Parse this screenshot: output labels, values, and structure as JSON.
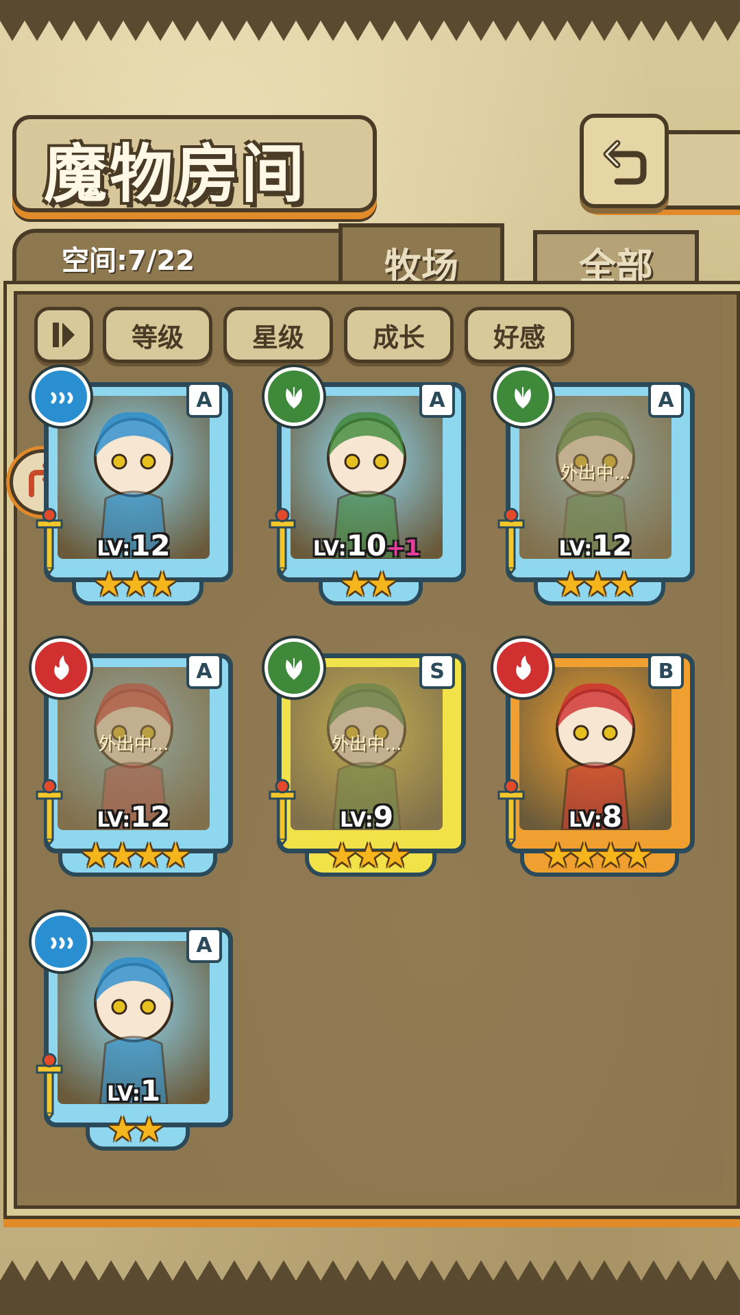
{
  "header": {
    "title": "魔物房间",
    "back_icon": "return-arrow-icon"
  },
  "storage": {
    "space_label": "空间:7/22"
  },
  "tabs": [
    {
      "label": "牧场",
      "active": true
    },
    {
      "label": "全部",
      "active": false
    }
  ],
  "sort_buttons": {
    "toggle_icon": "sort-order-icon",
    "items": [
      "等级",
      "星级",
      "成长",
      "好感"
    ]
  },
  "monsters": [
    {
      "element": "water",
      "rank": "A",
      "level": "12",
      "bonus": "",
      "stars": 3,
      "status": "",
      "frame_color": "#8fd6ef"
    },
    {
      "element": "nature",
      "rank": "A",
      "level": "10",
      "bonus": "+1",
      "stars": 2,
      "status": "",
      "frame_color": "#8fd6ef"
    },
    {
      "element": "nature",
      "rank": "A",
      "level": "12",
      "bonus": "",
      "stars": 3,
      "status": "外出中...",
      "frame_color": "#8fd6ef"
    },
    {
      "element": "fire",
      "rank": "A",
      "level": "12",
      "bonus": "",
      "stars": 4,
      "status": "外出中...",
      "frame_color": "#8fd6ef"
    },
    {
      "element": "nature",
      "rank": "S",
      "level": "9",
      "bonus": "",
      "stars": 3,
      "status": "外出中...",
      "frame_color": "#f2e24a"
    },
    {
      "element": "fire",
      "rank": "B",
      "level": "8",
      "bonus": "",
      "stars": 4,
      "status": "",
      "frame_color": "#f0a030"
    },
    {
      "element": "water",
      "rank": "A",
      "level": "1",
      "bonus": "",
      "stars": 2,
      "status": "",
      "frame_color": "#8fd6ef"
    }
  ],
  "labels": {
    "lv_prefix": "LV:"
  },
  "colors": {
    "water": "#2a8fd0",
    "nature": "#3f8a3a",
    "fire": "#d03030",
    "accent_orange": "#e08a2a",
    "outline": "#4a3b26"
  }
}
